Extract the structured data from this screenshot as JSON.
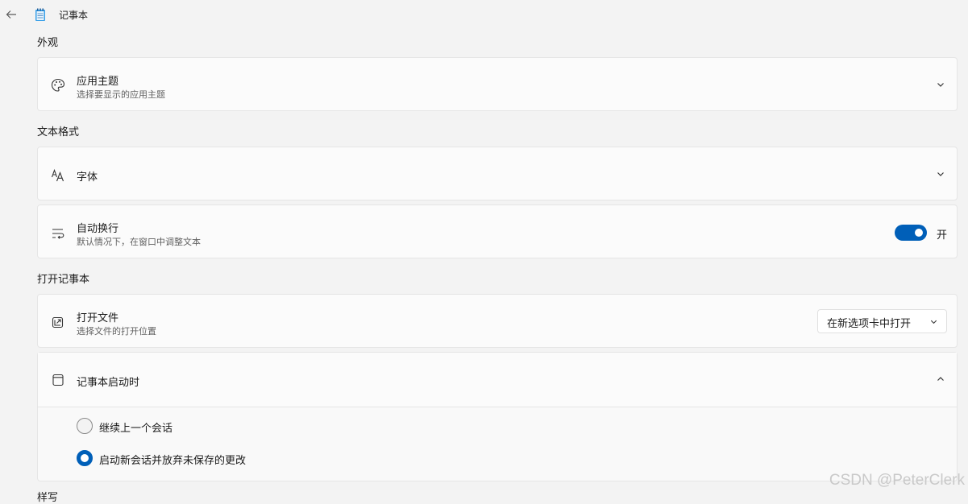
{
  "titlebar": {
    "app_title": "记事本",
    "back_icon": "back-arrow-icon",
    "app_icon": "notepad-icon"
  },
  "sections": {
    "appearance": "外观",
    "text_format": "文本格式",
    "open_notepad": "打开记事本",
    "next": "样写"
  },
  "app_theme": {
    "title": "应用主题",
    "subtitle": "选择要显示的应用主题",
    "icon": "palette-icon"
  },
  "font": {
    "title": "字体",
    "icon": "font-icon"
  },
  "word_wrap": {
    "title": "自动换行",
    "subtitle": "默认情况下，在窗口中调整文本",
    "state_label": "开",
    "enabled": true,
    "icon": "word-wrap-icon"
  },
  "open_file": {
    "title": "打开文件",
    "subtitle": "选择文件的打开位置",
    "selected": "在新选项卡中打开",
    "icon": "open-file-icon"
  },
  "on_start": {
    "title": "记事本启动时",
    "icon": "window-icon",
    "options": [
      {
        "label": "继续上一个会话",
        "selected": false
      },
      {
        "label": "启动新会话并放弃未保存的更改",
        "selected": true
      }
    ]
  },
  "watermark": "CSDN @PeterClerk",
  "colors": {
    "accent": "#005fb8",
    "background": "#f3f3f3",
    "card": "#fbfbfb"
  }
}
